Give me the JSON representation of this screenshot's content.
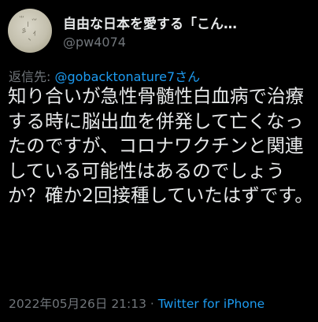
{
  "author": {
    "display_name": "自由な日本を愛する「こん…",
    "handle": "@pw4074"
  },
  "reply": {
    "prefix": "返信先: ",
    "mention": "@gobacktonature7",
    "suffix": "さん"
  },
  "tweet": {
    "text": "知り合いが急性骨髄性白血病で治療する時に脳出血を併発して亡くなったのですが、コロナワクチンと関連している可能性はあるのでしょうか？確か2回接種していたはずです。"
  },
  "meta": {
    "timestamp": "2022年05月26日 21:13",
    "separator": " · ",
    "source": "Twitter for iPhone"
  },
  "colors": {
    "background": "#000000",
    "text": "#e7e9ea",
    "secondary": "#71767b",
    "accent": "#1d9bf0"
  }
}
